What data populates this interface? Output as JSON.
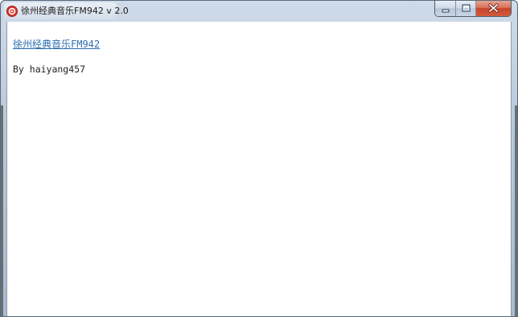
{
  "window": {
    "title": "徐州经典音乐FM942  v 2.0",
    "app_icon": "red-circle-app-icon"
  },
  "caption_buttons": {
    "minimize_icon": "minimize-icon",
    "maximize_icon": "maximize-icon",
    "close_icon": "close-icon"
  },
  "content": {
    "station_link": "徐州经典音乐FM942",
    "author": "By haiyang457"
  },
  "colors": {
    "link": "#2c6db2",
    "close_button": "#c7442b",
    "titlebar": "#b9c9da"
  }
}
